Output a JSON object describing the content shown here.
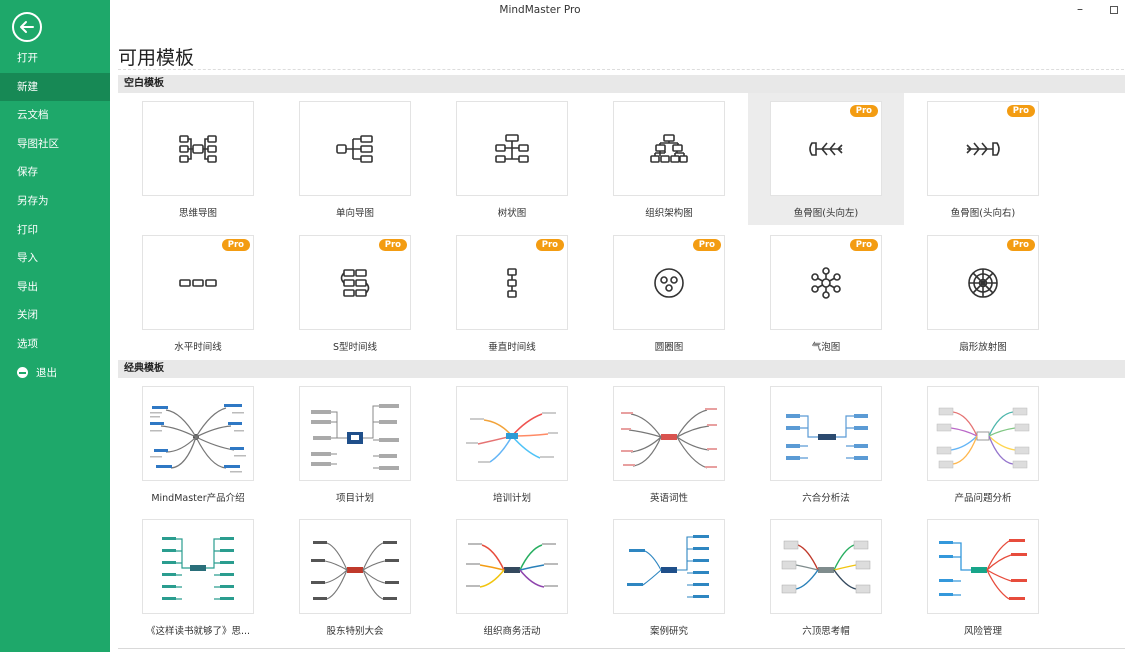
{
  "window": {
    "title": "MindMaster Pro"
  },
  "sidebar": {
    "items": [
      {
        "label": "打开"
      },
      {
        "label": "新建"
      },
      {
        "label": "云文档"
      },
      {
        "label": "导图社区"
      },
      {
        "label": "保存"
      },
      {
        "label": "另存为"
      },
      {
        "label": "打印"
      },
      {
        "label": "导入"
      },
      {
        "label": "导出"
      },
      {
        "label": "关闭"
      },
      {
        "label": "选项"
      },
      {
        "label": "退出"
      }
    ],
    "active_index": 1
  },
  "main": {
    "title": "可用模板",
    "pro_label": "Pro",
    "blank_section": {
      "label": "空白模板",
      "items": [
        {
          "label": "思维导图",
          "icon": "mindmap-icon"
        },
        {
          "label": "单向导图",
          "icon": "one-way-map-icon"
        },
        {
          "label": "树状图",
          "icon": "tree-chart-icon"
        },
        {
          "label": "组织架构图",
          "icon": "org-chart-icon"
        },
        {
          "label": "鱼骨图(头向左)",
          "icon": "fishbone-left-icon"
        },
        {
          "label": "鱼骨图(头向右)",
          "icon": "fishbone-right-icon"
        },
        {
          "label": "水平时间线",
          "icon": "horizontal-timeline-icon"
        },
        {
          "label": "S型时间线",
          "icon": "s-timeline-icon"
        },
        {
          "label": "垂直时间线",
          "icon": "vertical-timeline-icon"
        },
        {
          "label": "圆圈图",
          "icon": "circle-map-icon"
        },
        {
          "label": "气泡图",
          "icon": "bubble-map-icon"
        },
        {
          "label": "扇形放射图",
          "icon": "radial-map-icon"
        }
      ]
    },
    "classic_section": {
      "label": "经典模板",
      "items": [
        {
          "label": "MindMaster产品介绍"
        },
        {
          "label": "项目计划"
        },
        {
          "label": "培训计划"
        },
        {
          "label": "英语词性"
        },
        {
          "label": "六合分析法"
        },
        {
          "label": "产品问题分析"
        },
        {
          "label": "《这样读书就够了》思..."
        },
        {
          "label": "股东特别大会"
        },
        {
          "label": "组织商务活动"
        },
        {
          "label": "案例研究"
        },
        {
          "label": "六顶思考帽"
        },
        {
          "label": "风险管理"
        }
      ]
    }
  }
}
